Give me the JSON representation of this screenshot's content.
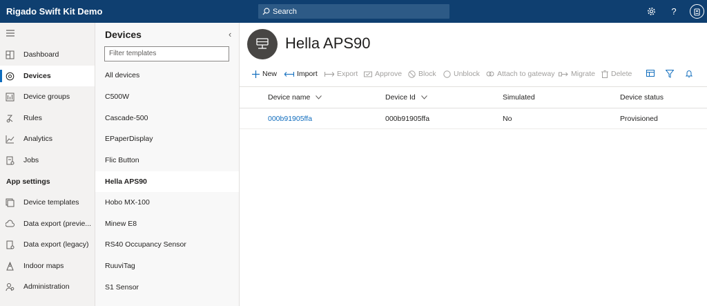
{
  "topbar": {
    "app_title": "Rigado Swift Kit Demo",
    "search_placeholder": "Search",
    "icons": [
      "gear-icon",
      "help-icon",
      "account-icon"
    ]
  },
  "leftnav": {
    "items": [
      {
        "label": "Dashboard",
        "icon": "dashboard-icon"
      },
      {
        "label": "Devices",
        "icon": "devices-icon",
        "active": true
      },
      {
        "label": "Device groups",
        "icon": "device-groups-icon"
      },
      {
        "label": "Rules",
        "icon": "rules-icon"
      },
      {
        "label": "Analytics",
        "icon": "analytics-icon"
      },
      {
        "label": "Jobs",
        "icon": "jobs-icon"
      }
    ],
    "section_label": "App settings",
    "settings_items": [
      {
        "label": "Device templates",
        "icon": "device-templates-icon"
      },
      {
        "label": "Data export (previe...",
        "icon": "cloud-export-icon"
      },
      {
        "label": "Data export (legacy)",
        "icon": "export-legacy-icon"
      },
      {
        "label": "Indoor maps",
        "icon": "map-icon"
      },
      {
        "label": "Administration",
        "icon": "admin-icon"
      }
    ]
  },
  "templates": {
    "title": "Devices",
    "filter_placeholder": "Filter templates",
    "items": [
      "All devices",
      "C500W",
      "Cascade-500",
      "EPaperDisplay",
      "Flic Button",
      "Hella APS90",
      "Hobo MX-100",
      "Minew E8",
      "RS40 Occupancy Sensor",
      "RuuviTag",
      "S1 Sensor"
    ],
    "active_index": 5
  },
  "main": {
    "title": "Hella APS90",
    "commands": [
      {
        "label": "New",
        "enabled": true
      },
      {
        "label": "Import",
        "enabled": true
      },
      {
        "label": "Export",
        "enabled": false
      },
      {
        "label": "Approve",
        "enabled": false
      },
      {
        "label": "Block",
        "enabled": false
      },
      {
        "label": "Unblock",
        "enabled": false
      },
      {
        "label": "Attach to gateway",
        "enabled": false
      },
      {
        "label": "Migrate",
        "enabled": false
      },
      {
        "label": "Delete",
        "enabled": false
      }
    ],
    "table": {
      "columns": [
        "Device name",
        "Device Id",
        "Simulated",
        "Device status"
      ],
      "rows": [
        [
          "000b91905ffa",
          "000b91905ffa",
          "No",
          "Provisioned"
        ]
      ]
    }
  },
  "colors": {
    "topbar": "#0f3f70",
    "accent": "#0f6cbd"
  }
}
